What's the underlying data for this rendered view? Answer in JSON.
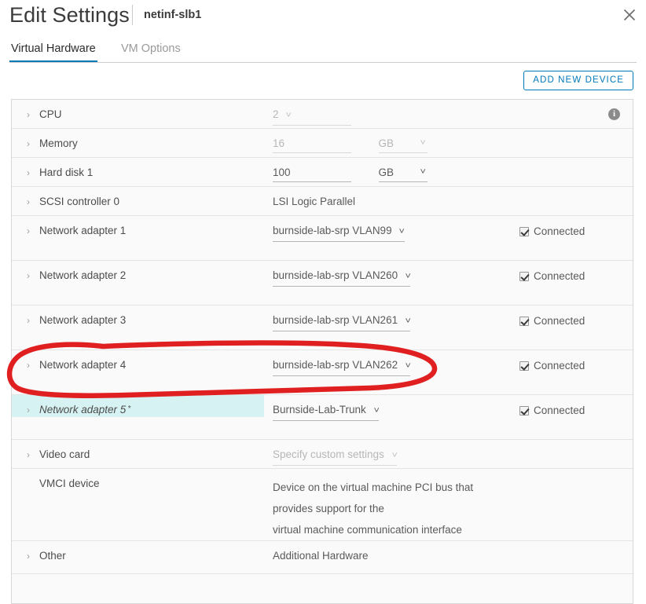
{
  "window": {
    "title": "Edit Settings",
    "subtitle": "netinf-slb1",
    "close_icon": "close-icon"
  },
  "tabs": [
    {
      "label": "Virtual Hardware",
      "active": true
    },
    {
      "label": "VM Options",
      "active": false
    }
  ],
  "toolbar": {
    "add_device_label": "ADD NEW DEVICE"
  },
  "colors": {
    "accent_blue": "#0079b8",
    "highlight_cyan": "#d7f2f2",
    "annotation_red": "#e02020",
    "border_grey": "#d8d8d8"
  },
  "devices": {
    "cpu": {
      "label": "CPU",
      "value": "2",
      "info_icon": "info-icon"
    },
    "memory": {
      "label": "Memory",
      "value": "16",
      "unit": "GB"
    },
    "hard_disk_1": {
      "label": "Hard disk 1",
      "value": "100",
      "unit": "GB"
    },
    "scsi_controller_0": {
      "label": "SCSI controller 0",
      "value": "LSI Logic Parallel"
    },
    "network_adapter_1": {
      "label": "Network adapter 1",
      "value": "burnside-lab-srp VLAN99",
      "connected_label": "Connected"
    },
    "network_adapter_2": {
      "label": "Network adapter 2",
      "value": "burnside-lab-srp VLAN260",
      "connected_label": "Connected"
    },
    "network_adapter_3": {
      "label": "Network adapter 3",
      "value": "burnside-lab-srp VLAN261",
      "connected_label": "Connected"
    },
    "network_adapter_4": {
      "label": "Network adapter 4",
      "value": "burnside-lab-srp VLAN262",
      "connected_label": "Connected"
    },
    "network_adapter_5": {
      "label": "Network adapter 5",
      "label_marker": "*",
      "value": "Burnside-Lab-Trunk",
      "connected_label": "Connected"
    },
    "video_card": {
      "label": "Video card",
      "value": "Specify custom settings"
    },
    "vmci_device": {
      "label": "VMCI device",
      "description_line_1": "Device on the virtual machine PCI bus that provides support for the",
      "description_line_2": "virtual machine communication interface"
    },
    "other": {
      "label": "Other",
      "value": "Additional Hardware"
    }
  },
  "annotation": {
    "shape": "hand-drawn-red-ellipse",
    "targets": "network-adapter-5-row"
  }
}
